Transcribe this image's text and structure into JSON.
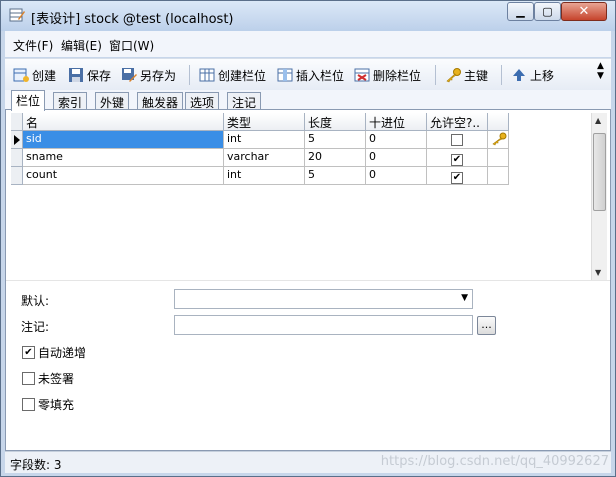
{
  "window": {
    "title": "[表设计] stock @test (localhost)",
    "minimize": "▁",
    "maximize": "▢",
    "close": "✕"
  },
  "menu": [
    "文件(F)",
    "编辑(E)",
    "窗口(W)"
  ],
  "toolbar": {
    "create": "创建",
    "save": "保存",
    "save_as": "另存为",
    "create_column": "创建栏位",
    "insert_column": "插入栏位",
    "delete_column": "删除栏位",
    "primary_key": "主键",
    "move_up": "上移"
  },
  "tabs": [
    "栏位",
    "索引",
    "外键",
    "触发器",
    "选项",
    "注记"
  ],
  "active_tab": "栏位",
  "grid": {
    "columns": [
      "名",
      "类型",
      "长度",
      "十进位",
      "允许空?.."
    ],
    "rows": [
      {
        "name": "sid",
        "type": "int",
        "length": "5",
        "decimals": "0",
        "allow_null": false,
        "primary_key": true,
        "selected": true
      },
      {
        "name": "sname",
        "type": "varchar",
        "length": "20",
        "decimals": "0",
        "allow_null": true,
        "primary_key": false,
        "selected": false
      },
      {
        "name": "count",
        "type": "int",
        "length": "5",
        "decimals": "0",
        "allow_null": true,
        "primary_key": false,
        "selected": false
      }
    ]
  },
  "properties": {
    "default_label": "默认:",
    "default_value": "",
    "comment_label": "注记:",
    "comment_value": "",
    "ellipsis": "...",
    "auto_increment_label": "自动递增",
    "auto_increment": true,
    "unsigned_label": "未签署",
    "unsigned": false,
    "zerofill_label": "零填充",
    "zerofill": false
  },
  "status": {
    "field_count": "字段数: 3"
  },
  "watermark": "https://blog.csdn.net/qq_40992627",
  "colors": {
    "selection": "#3a8ee6",
    "window_frame": "#c7d6ea"
  }
}
